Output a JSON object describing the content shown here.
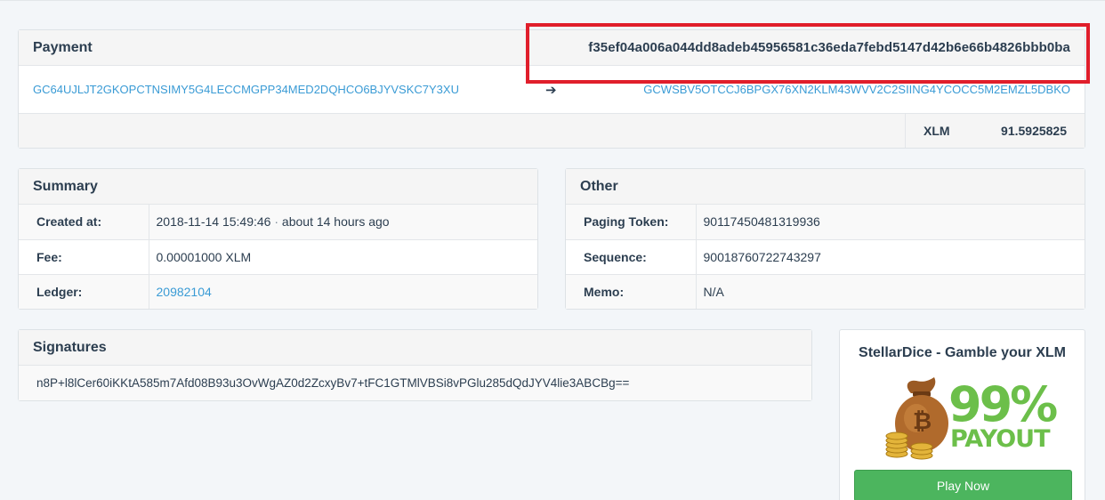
{
  "payment": {
    "title": "Payment",
    "tx_hash": "f35ef04a006a044dd8adeb45956581c36eda7febd5147d42b6e66b4826bbb0ba",
    "source": "GC64UJLJT2GKOPCTNSIMY5G4LECCMGPP34MED2DQHCO6BJYVSKC7Y3XU",
    "arrow": "➔",
    "destination": "GCWSBV5OTCCJ6BPGX76XN2KLM43WVV2C2SIING4YCOCC5M2EMZL5DBKO",
    "asset": "XLM",
    "amount": "91.5925825"
  },
  "summary": {
    "title": "Summary",
    "created_label": "Created at:",
    "created_value": "2018-11-14 15:49:46",
    "created_sep": " · ",
    "created_relative": "about 14 hours ago",
    "fee_label": "Fee:",
    "fee_value": "0.00001000 XLM",
    "ledger_label": "Ledger:",
    "ledger_value": "20982104"
  },
  "other": {
    "title": "Other",
    "paging_label": "Paging Token:",
    "paging_value": "90117450481319936",
    "sequence_label": "Sequence:",
    "sequence_value": "90018760722743297",
    "memo_label": "Memo:",
    "memo_value": "N/A"
  },
  "signatures": {
    "title": "Signatures",
    "items": [
      "n8P+l8lCer60iKKtA585m7Afd08B93u3OvWgAZ0d2ZcxyBv7+tFC1GTMlVBSi8vPGlu285dQdJYV4lie3ABCBg=="
    ]
  },
  "ad": {
    "title": "StellarDice - Gamble your XLM",
    "percent": "99%",
    "payout": "PAYOUT",
    "button_label": "Play Now"
  },
  "colors": {
    "link": "#3a9bd5",
    "highlight": "#e01e2b",
    "button": "#4cb55e",
    "ad_text": "#6cbf4a"
  }
}
